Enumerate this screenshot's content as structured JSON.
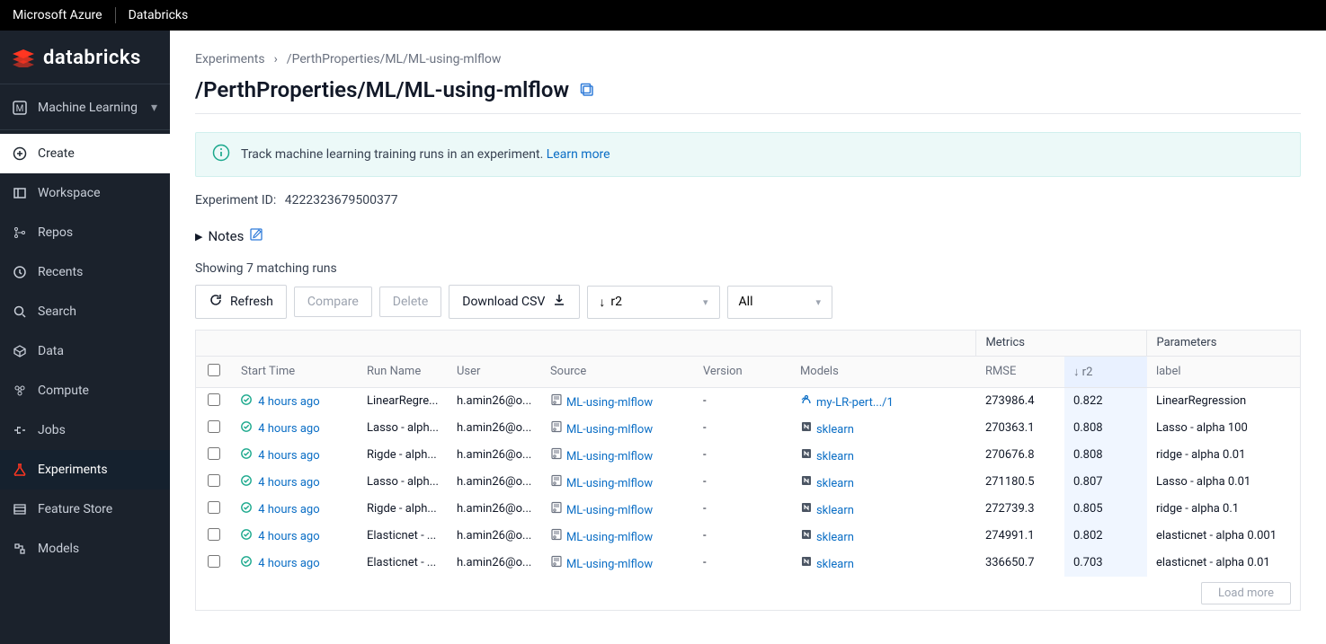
{
  "topbar": {
    "left": "Microsoft Azure",
    "right": "Databricks"
  },
  "brand": "databricks",
  "sidebar": {
    "persona": "Machine Learning",
    "items": [
      {
        "id": "create",
        "label": "Create",
        "icon": "plus-circle",
        "white": true
      },
      {
        "id": "workspace",
        "label": "Workspace",
        "icon": "workspace"
      },
      {
        "id": "repos",
        "label": "Repos",
        "icon": "repos"
      },
      {
        "id": "recents",
        "label": "Recents",
        "icon": "clock"
      },
      {
        "id": "search",
        "label": "Search",
        "icon": "search"
      },
      {
        "id": "data",
        "label": "Data",
        "icon": "data"
      },
      {
        "id": "compute",
        "label": "Compute",
        "icon": "compute"
      },
      {
        "id": "jobs",
        "label": "Jobs",
        "icon": "jobs"
      },
      {
        "id": "experiments",
        "label": "Experiments",
        "icon": "flask",
        "active": true
      },
      {
        "id": "featurestore",
        "label": "Feature Store",
        "icon": "feature"
      },
      {
        "id": "models",
        "label": "Models",
        "icon": "models"
      }
    ]
  },
  "crumbs": {
    "root": "Experiments",
    "path": "/PerthProperties/ML/ML-using-mlflow"
  },
  "title": "/PerthProperties/ML/ML-using-mlflow",
  "banner": {
    "text": "Track machine learning training runs in an experiment.",
    "link": "Learn more"
  },
  "experiment": {
    "id_label": "Experiment ID:",
    "id": "4222323679500377"
  },
  "notes_label": "Notes",
  "count_text": "Showing 7 matching runs",
  "toolbar": {
    "refresh": "Refresh",
    "compare": "Compare",
    "delete": "Delete",
    "download": "Download CSV",
    "sort": "r2",
    "filter": "All"
  },
  "table": {
    "super": {
      "metrics": "Metrics",
      "params": "Parameters"
    },
    "cols": {
      "start": "Start Time",
      "run": "Run Name",
      "user": "User",
      "source": "Source",
      "version": "Version",
      "models": "Models",
      "rmse": "RMSE",
      "r2": "r2",
      "label": "label"
    },
    "rows": [
      {
        "start": "4 hours ago",
        "run": "LinearRegre...",
        "user": "h.amin26@o...",
        "source": "ML-using-mlflow",
        "version": "-",
        "model": "my-LR-pert.../1",
        "model_kind": "reg",
        "rmse": "273986.4",
        "r2": "0.822",
        "label": "LinearRegression"
      },
      {
        "start": "4 hours ago",
        "run": "Lasso - alph...",
        "user": "h.amin26@o...",
        "source": "ML-using-mlflow",
        "version": "-",
        "model": "sklearn",
        "model_kind": "sk",
        "rmse": "270363.1",
        "r2": "0.808",
        "label": "Lasso - alpha 100"
      },
      {
        "start": "4 hours ago",
        "run": "Rigde - alph...",
        "user": "h.amin26@o...",
        "source": "ML-using-mlflow",
        "version": "-",
        "model": "sklearn",
        "model_kind": "sk",
        "rmse": "270676.8",
        "r2": "0.808",
        "label": "ridge - alpha 0.01"
      },
      {
        "start": "4 hours ago",
        "run": "Lasso - alph...",
        "user": "h.amin26@o...",
        "source": "ML-using-mlflow",
        "version": "-",
        "model": "sklearn",
        "model_kind": "sk",
        "rmse": "271180.5",
        "r2": "0.807",
        "label": "Lasso - alpha 0.01"
      },
      {
        "start": "4 hours ago",
        "run": "Rigde - alph...",
        "user": "h.amin26@o...",
        "source": "ML-using-mlflow",
        "version": "-",
        "model": "sklearn",
        "model_kind": "sk",
        "rmse": "272739.3",
        "r2": "0.805",
        "label": "ridge - alpha 0.1"
      },
      {
        "start": "4 hours ago",
        "run": "Elasticnet - ...",
        "user": "h.amin26@o...",
        "source": "ML-using-mlflow",
        "version": "-",
        "model": "sklearn",
        "model_kind": "sk",
        "rmse": "274991.1",
        "r2": "0.802",
        "label": "elasticnet - alpha 0.001"
      },
      {
        "start": "4 hours ago",
        "run": "Elasticnet - ...",
        "user": "h.amin26@o...",
        "source": "ML-using-mlflow",
        "version": "-",
        "model": "sklearn",
        "model_kind": "sk",
        "rmse": "336650.7",
        "r2": "0.703",
        "label": "elasticnet - alpha 0.01"
      }
    ],
    "load_more": "Load more"
  }
}
